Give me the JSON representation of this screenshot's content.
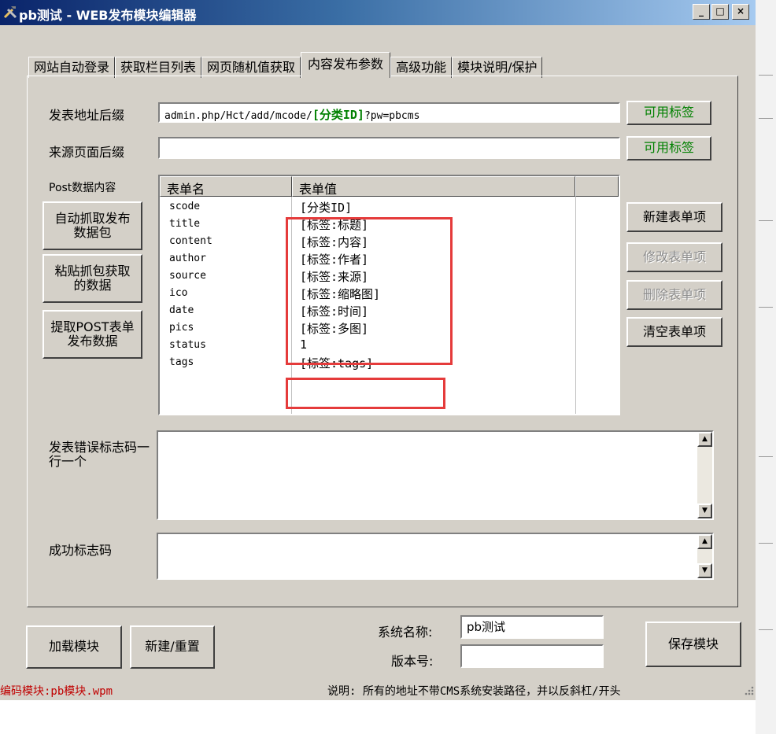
{
  "window": {
    "title": "pb测试 - WEB发布模块编辑器",
    "minimize_glyph": "_",
    "maximize_glyph": "□",
    "close_glyph": "×"
  },
  "tabs": [
    {
      "label": "网站自动登录"
    },
    {
      "label": "获取栏目列表"
    },
    {
      "label": "网页随机值获取"
    },
    {
      "label": "内容发布参数"
    },
    {
      "label": "高级功能"
    },
    {
      "label": "模块说明/保护"
    }
  ],
  "form": {
    "post_url": {
      "label": "发表地址后缀",
      "prefix": "admin.php/Hct/add/mcode/",
      "tag": "[分类ID]",
      "suffix": "?pw=pbcms",
      "tags_button": "可用标签"
    },
    "source_url": {
      "label": "来源页面后缀",
      "value": "",
      "tags_button": "可用标签"
    },
    "post_data_label": "Post数据内容"
  },
  "left_buttons": [
    {
      "label": "自动抓取发布数据包"
    },
    {
      "label": "粘贴抓包获取的数据"
    },
    {
      "label": "提取POST表单发布数据"
    }
  ],
  "table": {
    "columns": [
      "表单名",
      "表单值"
    ],
    "rows": [
      {
        "name": "scode",
        "value": "[分类ID]"
      },
      {
        "name": "title",
        "value": "[标签:标题]"
      },
      {
        "name": "content",
        "value": "[标签:内容]"
      },
      {
        "name": "author",
        "value": "[标签:作者]"
      },
      {
        "name": "source",
        "value": "[标签:来源]"
      },
      {
        "name": "ico",
        "value": "[标签:缩略图]"
      },
      {
        "name": "date",
        "value": "[标签:时间]"
      },
      {
        "name": "pics",
        "value": "[标签:多图]"
      },
      {
        "name": "status",
        "value": "1"
      },
      {
        "name": "tags",
        "value": "[标签:tags]"
      }
    ]
  },
  "right_buttons": [
    {
      "label": "新建表单项",
      "enabled": true
    },
    {
      "label": "修改表单项",
      "enabled": false
    },
    {
      "label": "删除表单项",
      "enabled": false
    },
    {
      "label": "清空表单项",
      "enabled": true
    }
  ],
  "error_codes": {
    "label": "发表错误标志码一行一个",
    "value": ""
  },
  "success_code": {
    "label": "成功标志码",
    "value": ""
  },
  "bottom": {
    "load_button": "加载模块",
    "new_button": "新建/重置",
    "system_name_label": "系统名称:",
    "system_name_value": "pb测试",
    "version_label": "版本号:",
    "version_value": "",
    "save_button": "保存模块"
  },
  "status": {
    "encoding": "编码模块:pb模块.wpm",
    "note": "说明: 所有的地址不带CMS系统安装路径，并以反斜杠/开头"
  },
  "colors": {
    "highlight_border": "#e53b3b",
    "tag_green": "#008000",
    "status_red": "#c00000",
    "title_gradient_start": "#0a246a"
  }
}
